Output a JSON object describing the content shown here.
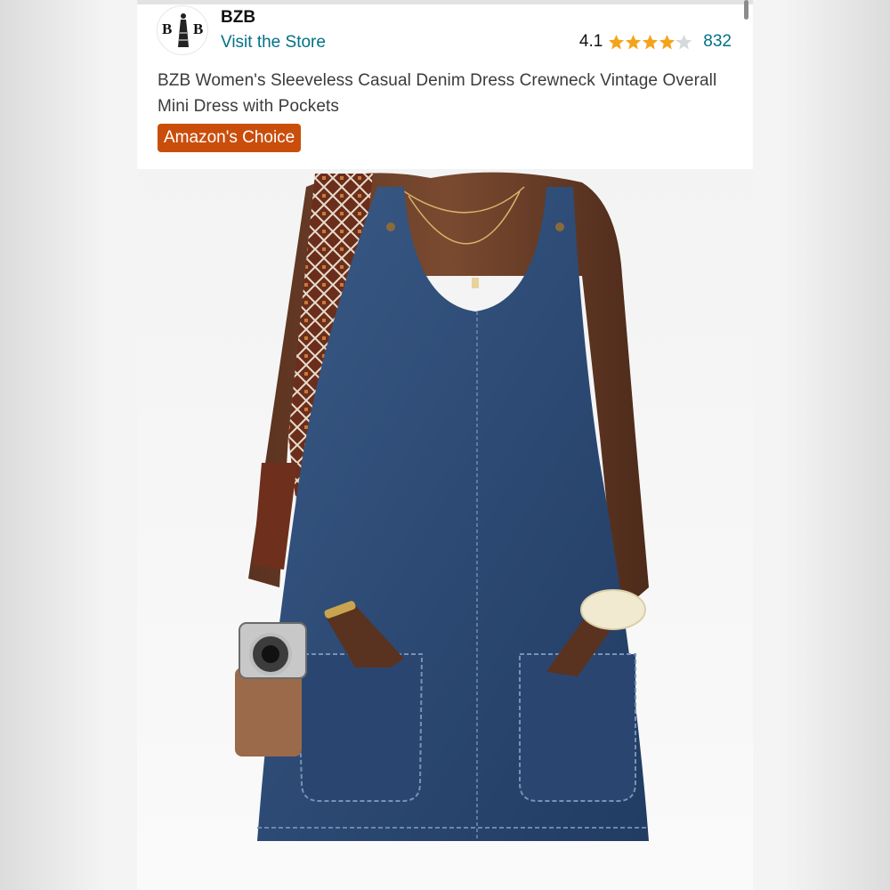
{
  "store": {
    "logo_text": "BZB",
    "name": "BZB",
    "visit_label": "Visit the Store"
  },
  "rating": {
    "value": "4.1",
    "stars": 4.1,
    "count": "832",
    "star_color": "#F4A41C",
    "empty_star_color": "#D5D9D9"
  },
  "product": {
    "title": "BZB Women's Sleeveless Casual Denim Dress Crewneck Vintage Overall Mini Dress with Pockets",
    "badge": "Amazon's Choice",
    "badge_color": "#C94E0C",
    "image_subject": "denim-overall-mini-dress"
  },
  "colors": {
    "link": "#007185",
    "denim": "#2F4D77"
  }
}
